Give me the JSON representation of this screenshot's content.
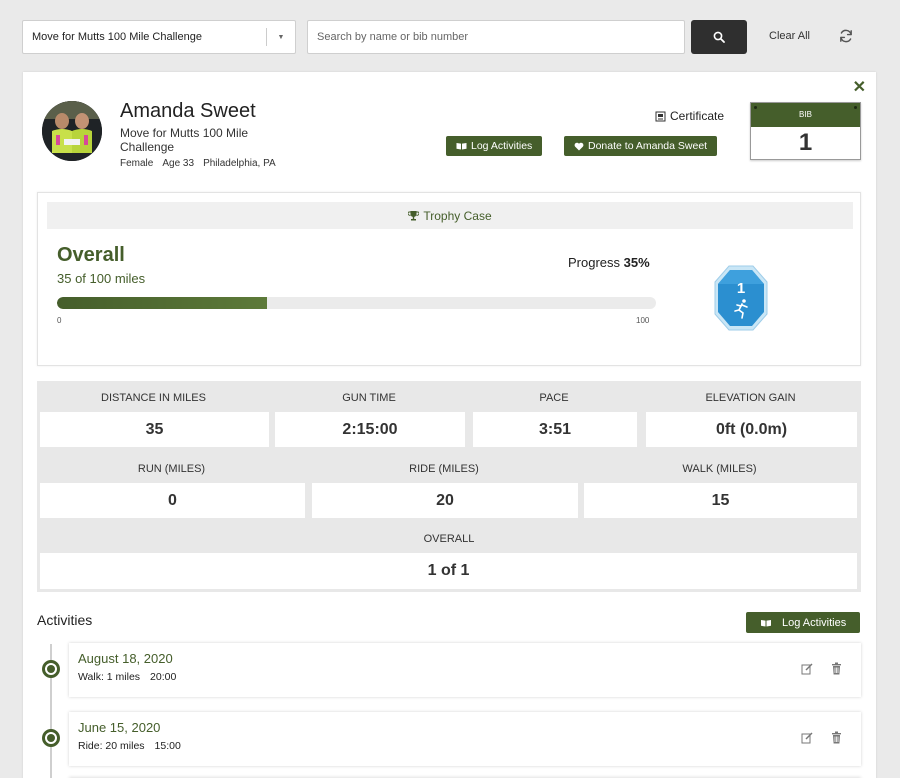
{
  "toolbar": {
    "event_select": "Move for Mutts 100 Mile Challenge",
    "search_placeholder": "Search by name or bib number",
    "search_icon": "search-icon",
    "clear_all": "Clear All",
    "refresh_icon": "refresh-icon"
  },
  "profile": {
    "name": "Amanda Sweet",
    "event": "Move for Mutts 100 Mile Challenge",
    "gender": "Female",
    "age": "Age 33",
    "location": "Philadelphia, PA",
    "certificate": "Certificate",
    "log_activities": "Log Activities",
    "donate": "Donate to Amanda Sweet",
    "bib_label": "BIB",
    "bib_number": "1"
  },
  "trophy": {
    "title": "Trophy Case",
    "overall_label": "Overall",
    "overall_sub": "35 of 100 miles",
    "progress_label": "Progress",
    "progress_value": "35%",
    "progress_fraction": 0.35,
    "min": "0",
    "max": "100",
    "badge_number": "1"
  },
  "stats": {
    "row1": [
      {
        "label": "DISTANCE IN MILES",
        "value": "35"
      },
      {
        "label": "GUN TIME",
        "value": "2:15:00"
      },
      {
        "label": "PACE",
        "value": "3:51"
      },
      {
        "label": "ELEVATION GAIN",
        "value": "0ft (0.0m)"
      }
    ],
    "row2": [
      {
        "label": "RUN (MILES)",
        "value": "0"
      },
      {
        "label": "RIDE (MILES)",
        "value": "20"
      },
      {
        "label": "WALK (MILES)",
        "value": "15"
      }
    ],
    "row3": [
      {
        "label": "OVERALL",
        "value": "1 of 1"
      }
    ]
  },
  "activities": {
    "title": "Activities",
    "log_button": "Log Activities",
    "items": [
      {
        "date": "August 18, 2020",
        "type": "Walk: 1 miles",
        "time": "20:00"
      },
      {
        "date": "June 15, 2020",
        "type": "Ride: 20 miles",
        "time": "15:00"
      }
    ]
  },
  "colors": {
    "brand_green": "#455e2b",
    "dark_button": "#2f2f2f",
    "badge_blue": "#2b8fd0"
  }
}
